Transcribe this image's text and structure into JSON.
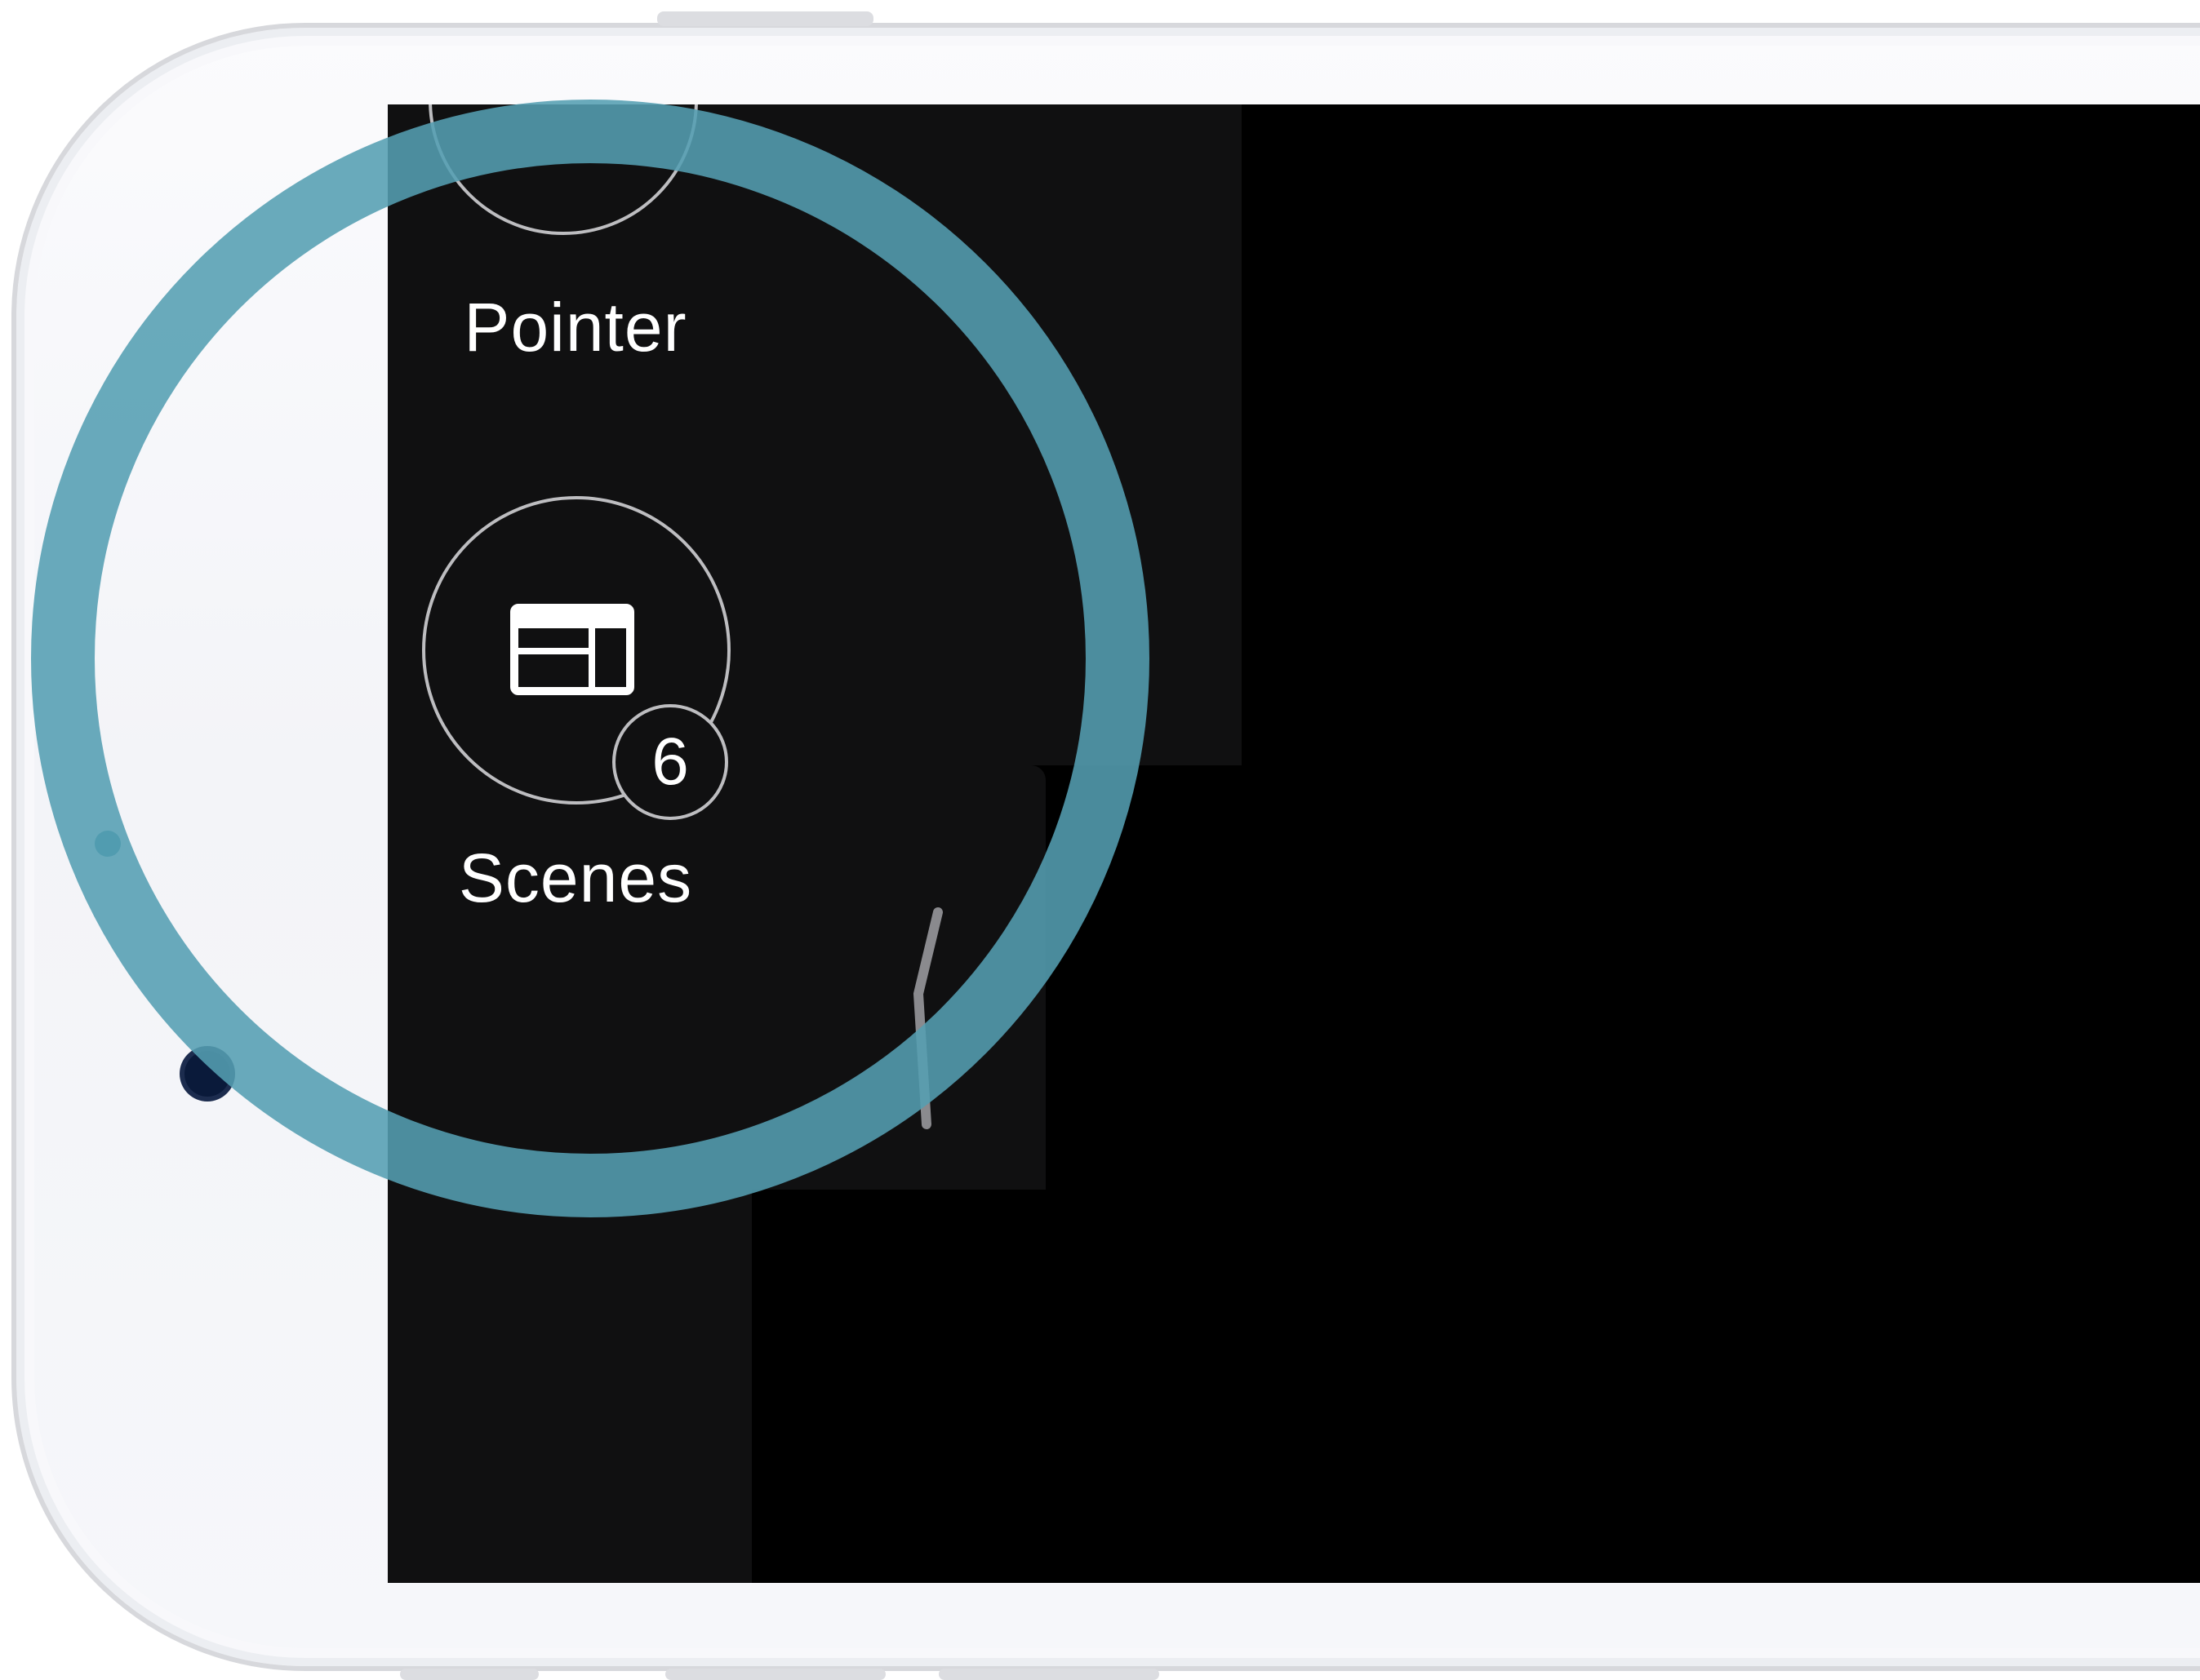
{
  "menu": {
    "pointer_label": "Pointer",
    "scenes_label": "Scenes",
    "scenes_count": "6"
  },
  "icons": {
    "pointer": "pointer-icon",
    "scenes": "scenes-layout-icon",
    "drag_handle": "drag-handle-icon"
  },
  "colors": {
    "focus_ring": "#549eb2",
    "panel": "#101011",
    "screen": "#000000",
    "device": "#f3f4f8"
  }
}
